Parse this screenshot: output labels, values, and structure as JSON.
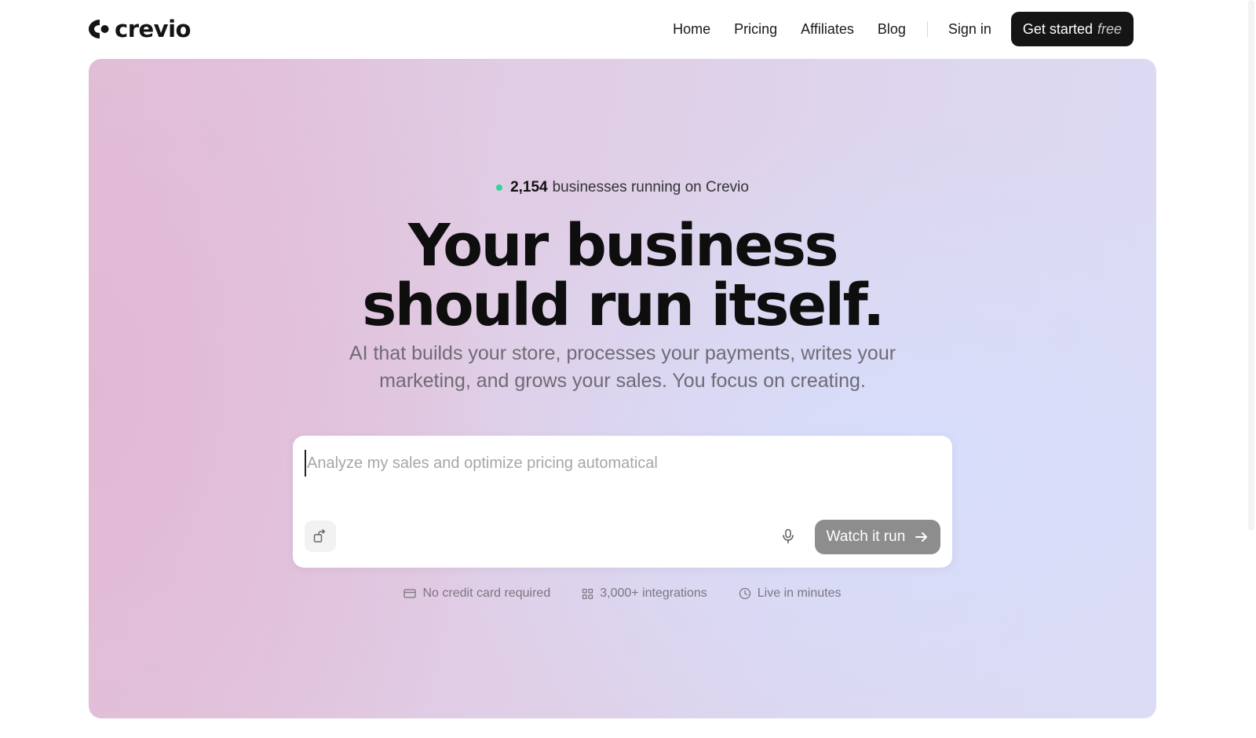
{
  "brand": {
    "name": "crevio"
  },
  "nav": {
    "items": [
      "Home",
      "Pricing",
      "Affiliates",
      "Blog"
    ],
    "sign_in": "Sign in",
    "cta_label": "Get started",
    "cta_emphasis": "free"
  },
  "hero": {
    "badge_count": "2,154",
    "badge_text": "businesses running on Crevio",
    "headline_line1": "Your business",
    "headline_line2": "should run itself.",
    "subhead_line1": "AI that builds your store, processes your payments, writes your",
    "subhead_line2": "marketing, and grows your sales. You focus on creating.",
    "prompt_placeholder": "Analyze my sales and optimize pricing automatical",
    "prompt_value": "",
    "run_label": "Watch it run"
  },
  "features": [
    {
      "icon": "credit-card-icon",
      "label": "No credit card required"
    },
    {
      "icon": "grid-icon",
      "label": "3,000+ integrations"
    },
    {
      "icon": "clock-icon",
      "label": "Live in minutes"
    }
  ],
  "colors": {
    "accent_dark": "#151515",
    "status_dot": "#37d39c",
    "run_button": "#8d8d8d"
  }
}
